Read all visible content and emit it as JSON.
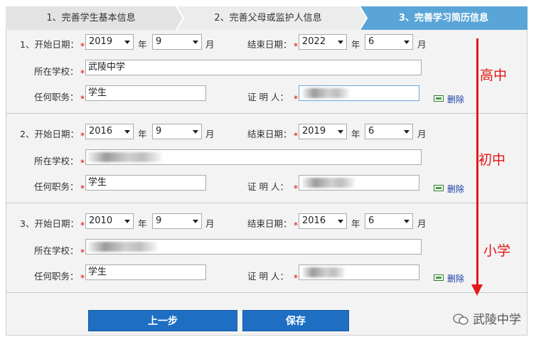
{
  "steps": [
    {
      "label": "1、完善学生基本信息"
    },
    {
      "label": "2、完善父母或监护人信息"
    },
    {
      "label": "3、完善学习简历信息"
    }
  ],
  "entries": [
    {
      "start_label": "1、开始日期：",
      "start_year": "2019",
      "start_month": "9",
      "end_label": "结束日期：",
      "end_year": "2022",
      "end_month": "6",
      "school_label": "所在学校：",
      "school": "武陵中学",
      "position_label": "任何职务：",
      "position": "学生",
      "witness_label": "证 明 人：",
      "witness": "",
      "delete_label": "删除",
      "annotation": "高中"
    },
    {
      "start_label": "2、开始日期：",
      "start_year": "2016",
      "start_month": "9",
      "end_label": "结束日期：",
      "end_year": "2019",
      "end_month": "6",
      "school_label": "所在学校：",
      "school": "",
      "position_label": "任何职务：",
      "position": "学生",
      "witness_label": "证 明 人：",
      "witness": "",
      "delete_label": "删除",
      "annotation": "初中"
    },
    {
      "start_label": "3、开始日期：",
      "start_year": "2010",
      "start_month": "9",
      "end_label": "结束日期：",
      "end_year": "2016",
      "end_month": "6",
      "school_label": "所在学校：",
      "school": "",
      "position_label": "任何职务：",
      "position": "学生",
      "witness_label": "证 明 人：",
      "witness": "",
      "delete_label": "删除",
      "annotation": "小学"
    }
  ],
  "units": {
    "year": "年",
    "month": "月",
    "required": "*"
  },
  "buttons": {
    "prev": "上一步",
    "save": "保存"
  },
  "watermark": "武陵中学",
  "colors": {
    "active_step": "#5aa5d8",
    "button": "#1e6fc4",
    "annotation": "#e31a1a",
    "required": "#dd0000"
  }
}
